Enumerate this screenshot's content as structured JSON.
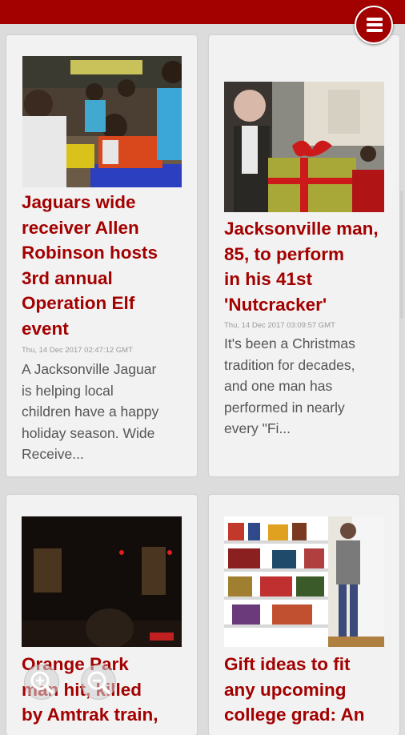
{
  "header": {
    "menu_icon": "hamburger-menu-icon",
    "color": "#a30000"
  },
  "articles": [
    {
      "title_lines": [
        "Jaguars wide",
        "receiver Allen",
        "Robinson hosts",
        "3rd annual",
        "Operation Elf",
        "event"
      ],
      "date": "Thu, 14 Dec 2017 02:47:12 GMT",
      "teaser_lines": [
        "A Jacksonville Jaguar",
        "is helping local",
        "children have a happy",
        "holiday season.  Wide",
        "Receive..."
      ]
    },
    {
      "title_lines": [
        "Jacksonville man,",
        "85, to perform",
        "in his 41st",
        "'Nutcracker'"
      ],
      "date": "Thu, 14 Dec 2017 03:09:57 GMT",
      "teaser_lines": [
        "It's been a Christmas",
        "tradition for decades,",
        "and one man has",
        "performed in nearly",
        "every \"Fi..."
      ]
    },
    {
      "title_lines": [
        "Orange Park",
        "man hit, killed",
        "by Amtrak train,"
      ]
    },
    {
      "title_lines": [
        "Gift ideas to fit",
        "any upcoming",
        "college grad: An"
      ]
    }
  ],
  "zoom_controls": {
    "zoom_in_icon": "zoom-in-icon",
    "zoom_out_icon": "zoom-out-icon"
  },
  "colors": {
    "accent": "#a30000",
    "card": "#f2f2f2",
    "background": "#dcdcdc"
  }
}
